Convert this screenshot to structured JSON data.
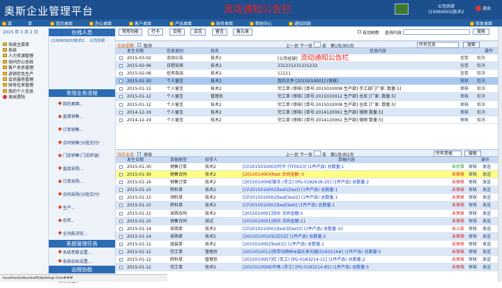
{
  "header": {
    "brand": "奥斯企业管理平台",
    "banner": "流动通知公告栏",
    "org": "公司总部",
    "user": "[10060003]技术2",
    "logout": "退出",
    "colors": {
      "bar": "#1d4f8f",
      "banner": "#e82020"
    }
  },
  "menubar": {
    "items": [
      "菜",
      "单",
      "我的桌面",
      "办公桌面",
      "客户桌面",
      "产品桌面",
      "财务桌面",
      "帮助中心",
      "通知回顾",
      "恢复桌面"
    ]
  },
  "left": {
    "date": "2015 年 3 月 2 日",
    "tree": [
      {
        "label": "系统主菜单"
      },
      {
        "label": "系统"
      },
      {
        "label": "人力资源管理"
      },
      {
        "label": "协同办公系统"
      },
      {
        "label": "客户关系管理"
      },
      {
        "label": "进销存及生产"
      },
      {
        "label": "会员服务管理"
      },
      {
        "label": "财务往来管理"
      },
      {
        "label": "我的个人信息"
      }
    ],
    "exit": "退出登陆"
  },
  "mid": {
    "online_title": "在线人员",
    "online_user": "[10060003]技术2",
    "online_org": "公司总部",
    "common_title": "常用业务流程",
    "links": [
      "我的桌面...",
      "直接销售...",
      "订单销售...",
      "合同销售(分批交付)",
      "门店销售(门店终端)",
      "直接采购...",
      "订单采购...",
      "合同采购(分批交付)",
      "生产...",
      "仓库...",
      "全功能浏览..."
    ],
    "system_title": "系统管理任务",
    "system_links": [
      "系统参数设置...",
      "系统初始设置..."
    ],
    "remote_title": "远程协助",
    "bottom_cut": "自客心址..."
  },
  "toolbar": {
    "buttons": [
      "常用功能",
      "打卡",
      "日程",
      "日志",
      "留言",
      "备忘录"
    ],
    "auto_refresh": "自动刷新",
    "query_label": "查询内容",
    "search": "搜索"
  },
  "info": {
    "title": "信息提醒",
    "cancel": "取消",
    "pager_prev": "上一页",
    "pager_next": "下一页",
    "pager_goto": "去",
    "pager_pages": "第1页/共5页",
    "filter": "所有信息",
    "search": "搜索",
    "headers": [
      "发生日期",
      "信息类别",
      "姓名",
      "信息内容",
      "操作"
    ],
    "rows": [
      {
        "date": "2015-03-02",
        "type": "流动公告",
        "name": "技术2",
        "content": "[公司总部]",
        "content_big": "流动通知公告栏",
        "op1": "查看",
        "op2": "取消"
      },
      {
        "date": "2015-02-06",
        "type": "日程安排",
        "name": "技术2",
        "content": "231231231231232",
        "op1": "查看",
        "op2": "取消"
      },
      {
        "date": "2015-02-06",
        "type": "任务指派",
        "name": "技术2",
        "content": "11111",
        "op1": "查看",
        "op2": "取消"
      },
      {
        "date": "2015-01-30",
        "type": "个人留言",
        "name": "技术2",
        "content": "我的文件 [2015010001] (审核)",
        "op1": "审核",
        "op2": "取消"
      },
      {
        "date": "2015-01-12",
        "type": "个人留言",
        "name": "技术2",
        "content": "完工单 (审核) [单号:2015010008 生产部] 手工部门厂家: 数量:5]",
        "op1": "审核",
        "op2": "取消"
      },
      {
        "date": "2015-01-12",
        "type": "个人留言",
        "name": "管理员",
        "content": "完工单 (审核) [单号:2015010012 生产部] 仓库 [厂家: 数量:5]",
        "op1": "审核",
        "op2": "取消"
      },
      {
        "date": "2015-01-12",
        "type": "个人留言",
        "name": "技术2",
        "content": "完工单 (审核) [单号:2015010008 生产部] 仓库 [厂家: 数量:5]",
        "op1": "审核",
        "op2": "取消"
      },
      {
        "date": "2014-12-19",
        "type": "个人留言",
        "name": "技术2",
        "content": "完工单 (审核) [单号:2014120061 生产部] 德顺 数量:5]",
        "op1": "审核",
        "op2": "取消"
      },
      {
        "date": "2014-12-19",
        "type": "个人留言",
        "name": "技术2",
        "content": "完工单 (审核) [单号:2014120061 生产部] 德顺 数量:5]",
        "op1": "审核",
        "op2": "取消"
      }
    ]
  },
  "tasks": {
    "title": "待办业务",
    "review": "审核",
    "pager_prev": "上一页",
    "pager_next": "下一页",
    "pager_goto": "去",
    "pager_pages": "第1页/共1页",
    "filter": "所有单据",
    "search": "搜索",
    "headers": [
      "发生日期",
      "单据类型",
      "经手人",
      "单据内容",
      "操作"
    ],
    "rows": [
      {
        "date": "2015-01-30",
        "type": "销售订单",
        "handler": "技术2",
        "content": "[CF2015010003]叶片 [TF0023] (1件产品) 总数量:1",
        "status": "未开单",
        "status_color": "green",
        "op1": "审核",
        "op2": "发送"
      },
      {
        "date": "2015-01-30",
        "type": "销售合同",
        "handler": "技术2",
        "content": "[2015010004]test 合同金额: 0",
        "status": "未审核",
        "status_color": "red",
        "op1": "审核",
        "op2": "发送",
        "highlight": true
      },
      {
        "date": "2015-01-16",
        "type": "销售订单",
        "handler": "技术2",
        "content": "[2015010008]菊东 (手工) [PG-0182618-25] (1件产品) 总数量:2",
        "status": "未审核",
        "status_color": "red",
        "op1": "审核",
        "op2": "发送"
      },
      {
        "date": "2015-01-15",
        "type": "转料单",
        "handler": "技术2",
        "content": "[CF2015010002]test1[test] (1件产品) 总数量:1",
        "status": "未审核",
        "status_color": "red",
        "op1": "审核",
        "op2": "发送"
      },
      {
        "date": "2015-01-15",
        "type": "领料单",
        "handler": "技术2",
        "content": "[CF2015010002]test[test2] (1件产品) 总数量:1",
        "status": "未审核",
        "status_color": "red",
        "op1": "审核",
        "op2": "发送"
      },
      {
        "date": "2015-01-15",
        "type": "转料单",
        "handler": "技术2",
        "content": "[CF2015010001]test[test] (1件产品) 总数量:1",
        "status": "未审核",
        "status_color": "red",
        "op1": "审核",
        "op2": "发送"
      },
      {
        "date": "2015-01-15",
        "type": "采购合同",
        "handler": "技术2",
        "content": "[2015010001]协乐 合同金额:5",
        "status": "未审核",
        "status_color": "red",
        "op1": "审核",
        "op2": "发送"
      },
      {
        "date": "2015-01-15",
        "type": "销售合同",
        "handler": "测试",
        "content": "[2015010001]协乐 合同金额:11",
        "status": "未审核",
        "status_color": "red",
        "op1": "审核",
        "op2": "发送"
      },
      {
        "date": "2015-01-14",
        "type": "采购单",
        "handler": "技术2",
        "content": "[CF2015010001]test3[test3] (1件产品) 总数量:10",
        "status": "未入库",
        "status_color": "red",
        "op1": "审核",
        "op2": "发送"
      },
      {
        "date": "2015-01-14",
        "type": "采购单",
        "handler": "技术2",
        "content": "[2015010010]OZ[OZ] (1件产品) 总数量:2",
        "status": "未审核",
        "status_color": "red",
        "op1": "审核",
        "op2": "发送"
      },
      {
        "date": "2015-01-12",
        "type": "组装单",
        "handler": "技术2",
        "content": "[2015010002]test1[] (1件产品) 总数量:1",
        "status": "未审核",
        "status_color": "red",
        "op1": "审核",
        "op2": "发送"
      },
      {
        "date": "2015-01-12",
        "type": "完工单",
        "handler": "管理员",
        "content": "[2015010012]热带动物树#森乐发光器[0183214#] (1件产品) 总数量:5",
        "status": "未审核",
        "status_color": "red",
        "op1": "审核",
        "op2": "发送"
      },
      {
        "date": "2015-01-12",
        "type": "转料单",
        "handler": "管理员",
        "content": "[2015010007]红 (车工) [PG-0183214-1C] (1件产品) 总数量:2",
        "status": "未审核",
        "status_color": "red",
        "op1": "审核",
        "op2": "发送"
      },
      {
        "date": "2015-01-12",
        "type": "完工单",
        "handler": "技术2",
        "content": "[2015010008]鸟龟 (手工) [PG-0183214-85] (1件产品) 总数量:5",
        "status": "未审核",
        "status_color": "red",
        "op1": "审核",
        "op2": "发送"
      }
    ]
  },
  "statusbar": {
    "url": "localhost/ebs/staff/desktop.htm###"
  }
}
